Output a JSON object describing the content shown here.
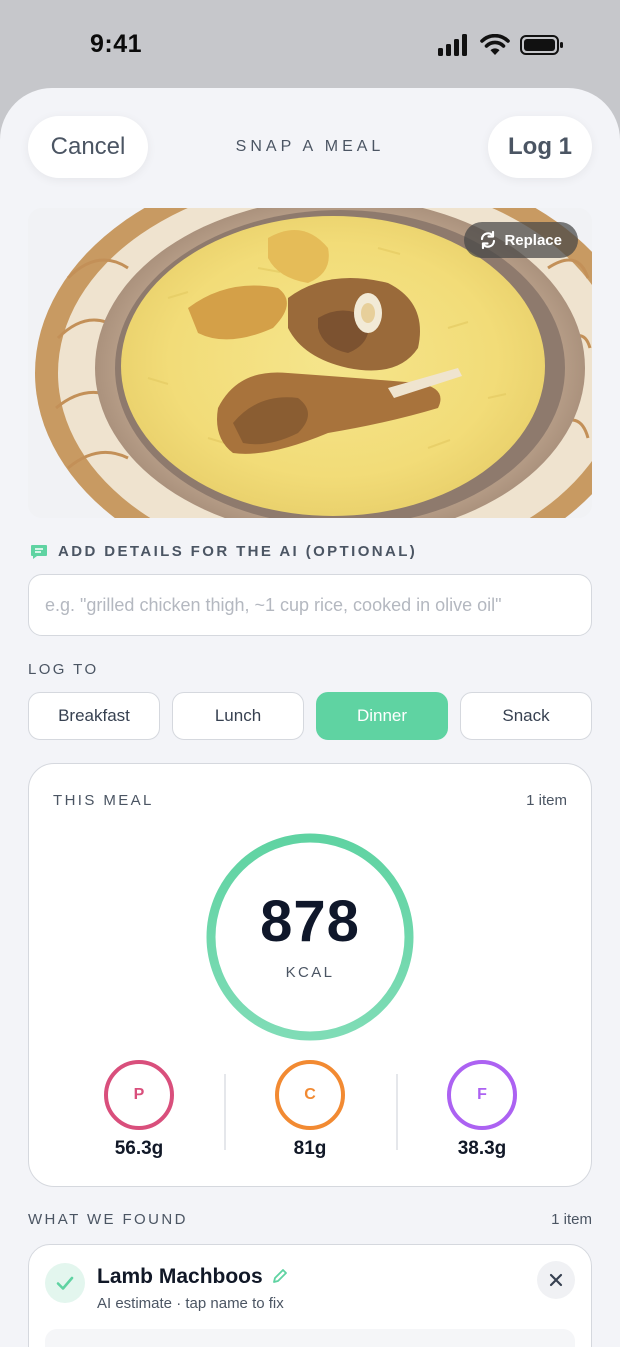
{
  "status_bar": {
    "time": "9:41"
  },
  "header": {
    "cancel_label": "Cancel",
    "title": "SNAP A MEAL",
    "log_label": "Log 1"
  },
  "photo": {
    "replace_label": "Replace"
  },
  "ai_details": {
    "label": "ADD DETAILS FOR THE AI (OPTIONAL)",
    "placeholder": "e.g. \"grilled chicken thigh, ~1 cup rice, cooked in olive oil\"",
    "value": ""
  },
  "log_to": {
    "label": "LOG TO",
    "options": [
      "Breakfast",
      "Lunch",
      "Dinner",
      "Snack"
    ],
    "selected": "Dinner"
  },
  "this_meal": {
    "title": "THIS MEAL",
    "count": "1 item",
    "kcal": "878",
    "kcal_label": "KCAL",
    "macros": [
      {
        "letter": "P",
        "value": "56.3g",
        "color": "#d94f7c"
      },
      {
        "letter": "C",
        "value": "81g",
        "color": "#f28a32"
      },
      {
        "letter": "F",
        "value": "38.3g",
        "color": "#ac62f2"
      }
    ]
  },
  "found": {
    "label": "WHAT WE FOUND",
    "count": "1 item",
    "items": [
      {
        "name": "Lamb Machboos",
        "subtitle": "AI estimate · tap name to fix"
      }
    ]
  },
  "colors": {
    "accent": "#5fd3a2",
    "sheet_bg": "#f3f4f8",
    "text_muted": "#4b5563"
  }
}
